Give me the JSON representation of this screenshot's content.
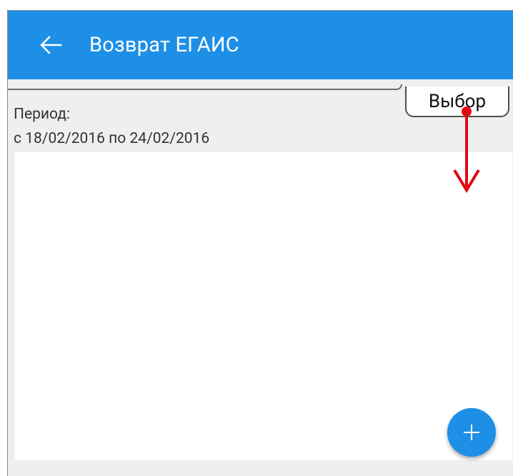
{
  "appbar": {
    "title": "Возврат ЕГАИС",
    "back_icon": "arrow-left-icon"
  },
  "filter": {
    "tab_label": "Выбор",
    "period_label": "Период:",
    "period_range": "с 18/02/2016 по 24/02/2016"
  },
  "fab": {
    "icon": "plus-icon"
  },
  "annotation": {
    "icon": "red-down-arrow",
    "color": "#e30613"
  },
  "colors": {
    "primary": "#1e8fe6",
    "background": "#efefef"
  }
}
